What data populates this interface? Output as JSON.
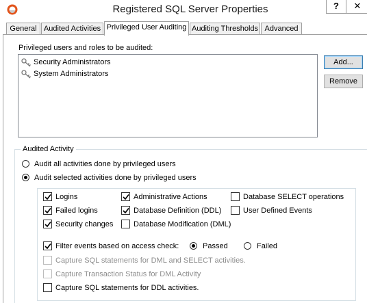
{
  "window": {
    "title": "Registered SQL Server Properties",
    "help_label": "?",
    "close_label": "✕"
  },
  "tabs": [
    {
      "label": "General"
    },
    {
      "label": "Audited Activities"
    },
    {
      "label": "Privileged User Auditing",
      "active": true
    },
    {
      "label": "Auditing Thresholds"
    },
    {
      "label": "Advanced"
    }
  ],
  "privileged": {
    "label": "Privileged users and roles to be audited:",
    "items": [
      "Security Administrators",
      "System Administrators"
    ],
    "add_label": "Add...",
    "remove_label": "Remove"
  },
  "audited_activity": {
    "title": "Audited Activity",
    "radio_all": "Audit all activities done by privileged users",
    "radio_selected": "Audit selected activities done by privileged users",
    "selected_option": "selected"
  },
  "activities": {
    "logins": {
      "label": "Logins",
      "checked": true
    },
    "failed_logins": {
      "label": "Failed logins",
      "checked": true
    },
    "security_changes": {
      "label": "Security changes",
      "checked": true
    },
    "admin_actions": {
      "label": "Administrative Actions",
      "checked": true
    },
    "ddl": {
      "label": "Database Definition (DDL)",
      "checked": true
    },
    "dml": {
      "label": "Database Modification (DML)",
      "checked": false
    },
    "select_ops": {
      "label": "Database SELECT operations",
      "checked": false
    },
    "user_events": {
      "label": "User Defined Events",
      "checked": false
    }
  },
  "filter": {
    "label": "Filter events based on access check:",
    "checked": true,
    "passed_label": "Passed",
    "failed_label": "Failed",
    "selected": "passed"
  },
  "capture": {
    "dml_select": {
      "label": "Capture SQL statements for DML and SELECT activities.",
      "checked": false,
      "enabled": false
    },
    "transaction": {
      "label": "Capture Transaction Status for DML Activity",
      "checked": false,
      "enabled": false
    },
    "ddl": {
      "label": "Capture SQL statements for DDL activities.",
      "checked": false,
      "enabled": true
    }
  },
  "colors": {
    "accent_border": "#3c7fb1",
    "disabled_text": "#8d8d8d"
  }
}
